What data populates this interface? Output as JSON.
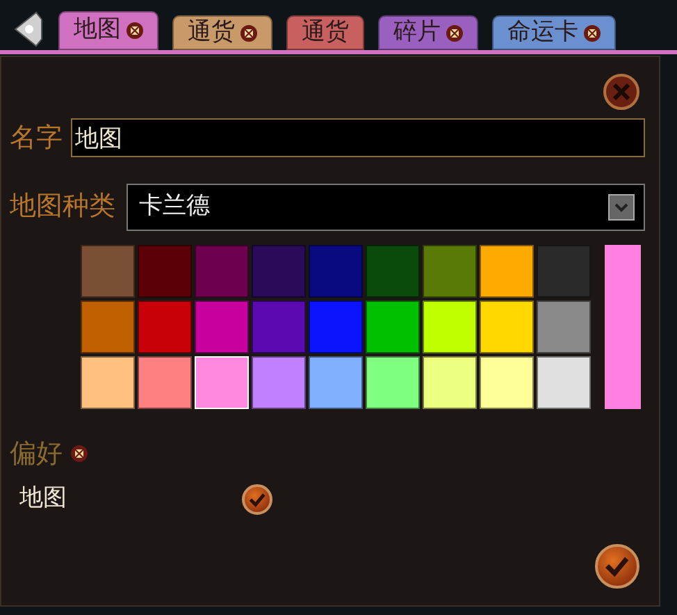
{
  "tabs": [
    {
      "label": "地图",
      "color": "#d070c0",
      "selected": true,
      "badge": true
    },
    {
      "label": "通货",
      "color": "#c89a6a",
      "selected": false,
      "badge": true
    },
    {
      "label": "通货",
      "color": "#c86060",
      "selected": false,
      "badge": false
    },
    {
      "label": "碎片",
      "color": "#9a60c0",
      "selected": false,
      "badge": true
    },
    {
      "label": "命运卡",
      "color": "#6a90d0",
      "selected": false,
      "badge": true
    }
  ],
  "name_field": {
    "label": "名字",
    "value": "地图"
  },
  "type_select": {
    "label": "地图种类",
    "value": "卡兰德"
  },
  "swatches": [
    {
      "color": "#7a4f35",
      "selected": false
    },
    {
      "color": "#5c0008",
      "selected": false
    },
    {
      "color": "#6e0050",
      "selected": false
    },
    {
      "color": "#2a0a5a",
      "selected": false
    },
    {
      "color": "#0a0a80",
      "selected": false
    },
    {
      "color": "#0a4a0a",
      "selected": false
    },
    {
      "color": "#5a7a08",
      "selected": false
    },
    {
      "color": "#ffaa00",
      "selected": false
    },
    {
      "color": "#2a2a2a",
      "selected": false
    },
    {
      "color": "#c06000",
      "selected": false
    },
    {
      "color": "#c80008",
      "selected": false
    },
    {
      "color": "#c800a0",
      "selected": false
    },
    {
      "color": "#5a0ab0",
      "selected": false
    },
    {
      "color": "#0a14ff",
      "selected": false
    },
    {
      "color": "#00c000",
      "selected": false
    },
    {
      "color": "#c0ff00",
      "selected": false
    },
    {
      "color": "#ffd800",
      "selected": false
    },
    {
      "color": "#8a8a8a",
      "selected": false
    },
    {
      "color": "#ffc080",
      "selected": false
    },
    {
      "color": "#ff8080",
      "selected": false
    },
    {
      "color": "#ff88e0",
      "selected": true
    },
    {
      "color": "#c080ff",
      "selected": false
    },
    {
      "color": "#80b0ff",
      "selected": false
    },
    {
      "color": "#80ff80",
      "selected": false
    },
    {
      "color": "#eeff80",
      "selected": false
    },
    {
      "color": "#ffff99",
      "selected": false
    },
    {
      "color": "#e0e0e0",
      "selected": false
    }
  ],
  "preview": {
    "color": "#ff80e0"
  },
  "preferences": {
    "label": "偏好",
    "items": [
      {
        "label": "地图",
        "checked": true
      }
    ]
  }
}
